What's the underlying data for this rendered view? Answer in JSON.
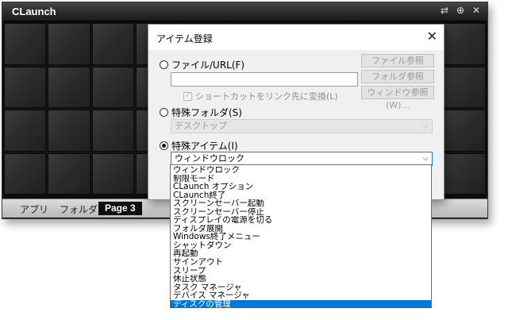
{
  "launcher": {
    "title": "CLaunch",
    "controls": [
      "⇄",
      "⊕",
      "✕"
    ],
    "tabs": [
      {
        "label": "アプリ",
        "active": false
      },
      {
        "label": "フォルダ",
        "active": false
      },
      {
        "label": "Page 3",
        "active": true
      }
    ]
  },
  "dialog": {
    "title": "アイテム登録",
    "close_label": "✕",
    "file_option": {
      "label": "ファイル/URL(F)",
      "checked": false,
      "path_value": "",
      "shortcut_checkbox": "ショートカットをリンク先に変換(L)",
      "buttons": [
        "ファイル参照(B)...",
        "フォルダ参照(R)...",
        "ウィンドウ参照(W)..."
      ]
    },
    "special_folder_option": {
      "label": "特殊フォルダ(S)",
      "checked": false,
      "selected": "デスクトップ"
    },
    "special_item_option": {
      "label": "特殊アイテム(I)",
      "checked": true,
      "selected": "ウィンドウロック"
    }
  },
  "dropdown": {
    "items": [
      "ウィンドウロック",
      "制限モード",
      "CLaunch オプション",
      "CLaunch終了",
      "スクリーンセーバー起動",
      "スクリーンセーバー停止",
      "ディスプレイの電源を切る",
      "フォルダ展開",
      "Windows終了メニュー",
      "シャットダウン",
      "再起動",
      "サインアウト",
      "スリープ",
      "休止状態",
      "タスク マネージャ",
      "デバイス マネージャ",
      "ディスクの管理"
    ],
    "selected_index": 16
  },
  "colors": {
    "selection": "#0078d7",
    "launcher_bg": "#0d0d0d"
  }
}
